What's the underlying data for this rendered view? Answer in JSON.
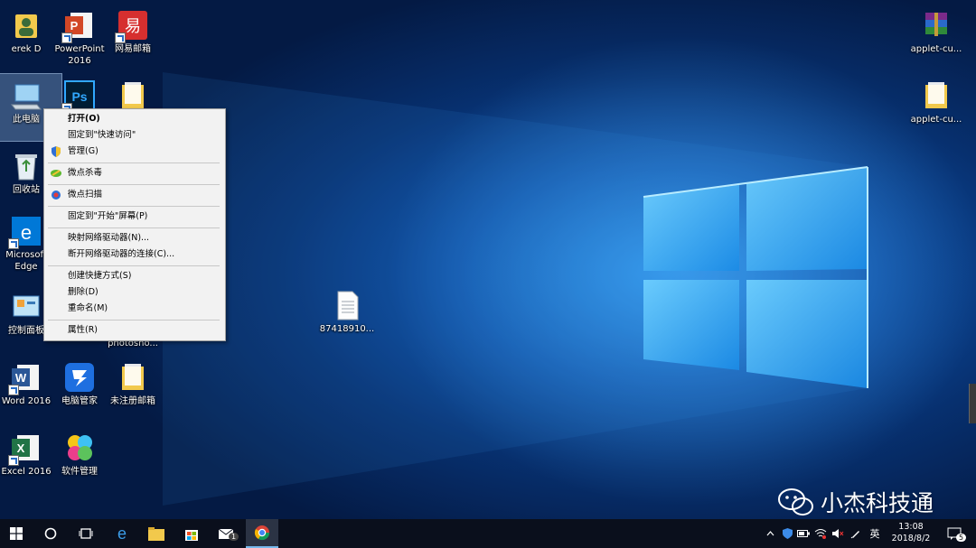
{
  "desktop": {
    "icons": [
      {
        "label": "erek D"
      },
      {
        "label": "PowerPoint\n2016"
      },
      {
        "label": "网易邮箱"
      },
      {
        "label": "此电脑"
      },
      {
        "label": ""
      },
      {
        "label": ""
      },
      {
        "label": "回收站"
      },
      {
        "label": "Microsoft\nEdge"
      },
      {
        "label": "控制面板"
      },
      {
        "label": "photosho..."
      },
      {
        "label": "87418910..."
      },
      {
        "label": "Word 2016"
      },
      {
        "label": "电脑管家"
      },
      {
        "label": "未注册邮箱"
      },
      {
        "label": "Excel 2016"
      },
      {
        "label": "软件管理"
      },
      {
        "label": "applet-cu..."
      },
      {
        "label": "applet-cu..."
      }
    ]
  },
  "context_menu": {
    "items": [
      {
        "label": "打开(O)"
      },
      {
        "label": "固定到\"快速访问\""
      },
      {
        "label": "管理(G)"
      },
      {
        "label": "微点杀毒"
      },
      {
        "label": "微点扫描"
      },
      {
        "label": "固定到\"开始\"屏幕(P)"
      },
      {
        "label": "映射网络驱动器(N)..."
      },
      {
        "label": "断开网络驱动器的连接(C)..."
      },
      {
        "label": "创建快捷方式(S)"
      },
      {
        "label": "删除(D)"
      },
      {
        "label": "重命名(M)"
      },
      {
        "label": "属性(R)"
      }
    ]
  },
  "taskbar": {
    "tray_ime": "英",
    "clock_time": "13:08",
    "clock_date": "2018/8/2",
    "notification_count": "5",
    "mail_badge": "1"
  },
  "watermark": {
    "text": "小杰科技通"
  },
  "colors": {
    "accent": "#0078d7",
    "taskbar": "#0a0f1c",
    "menu_bg": "#f2f2f2"
  }
}
